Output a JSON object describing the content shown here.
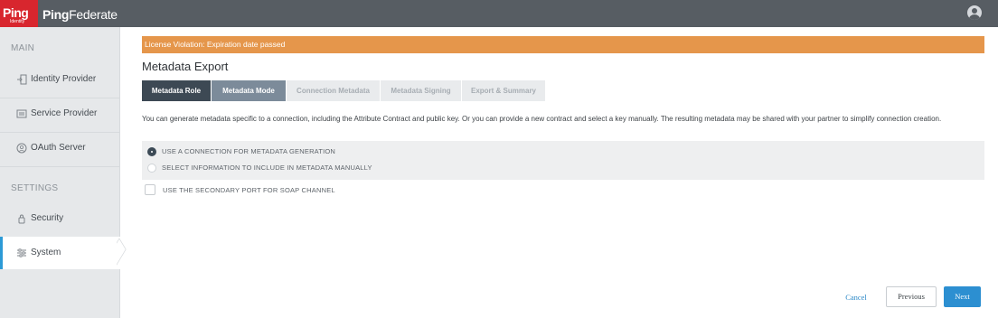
{
  "header": {
    "logo_text": "Ping",
    "logo_subtext": "Identity",
    "product_bold": "Ping",
    "product_light": "Federate",
    "user_icon": "user-avatar-icon"
  },
  "sidebar": {
    "sections": [
      {
        "label": "MAIN"
      },
      {
        "label": "SETTINGS"
      }
    ],
    "items": [
      {
        "label": "Identity Provider",
        "icon": "identity-provider-icon"
      },
      {
        "label": "Service Provider",
        "icon": "service-provider-icon"
      },
      {
        "label": "OAuth Server",
        "icon": "oauth-icon"
      },
      {
        "label": "Security",
        "icon": "lock-icon"
      },
      {
        "label": "System",
        "icon": "sliders-icon",
        "active": true
      }
    ]
  },
  "alert": {
    "text": "License Violation: Expiration date passed",
    "color": "#e5964b"
  },
  "page": {
    "title": "Metadata Export",
    "description": "You can generate metadata specific to a connection, including the Attribute Contract and public key. Or you can provide a new contract and select a key manually. The resulting metadata may be shared with your partner to simplify connection creation."
  },
  "tabs": [
    {
      "label": "Metadata Role",
      "state": "current"
    },
    {
      "label": "Metadata Mode",
      "state": "done"
    },
    {
      "label": "Connection Metadata",
      "state": "pending"
    },
    {
      "label": "Metadata Signing",
      "state": "pending"
    },
    {
      "label": "Export & Summary",
      "state": "pending"
    }
  ],
  "options": {
    "radios": [
      {
        "label": "USE A CONNECTION FOR METADATA GENERATION",
        "checked": true
      },
      {
        "label": "SELECT INFORMATION TO INCLUDE IN METADATA MANUALLY",
        "checked": false
      }
    ],
    "checkbox": {
      "label": "USE THE SECONDARY PORT FOR SOAP CHANNEL",
      "checked": false
    }
  },
  "footer": {
    "cancel": "Cancel",
    "previous": "Previous",
    "next": "Next"
  },
  "colors": {
    "topbar": "#575d63",
    "logo": "#d8262e",
    "accent": "#2c8fd1",
    "tab_current": "#3d4954",
    "tab_done": "#7c8b9a"
  }
}
